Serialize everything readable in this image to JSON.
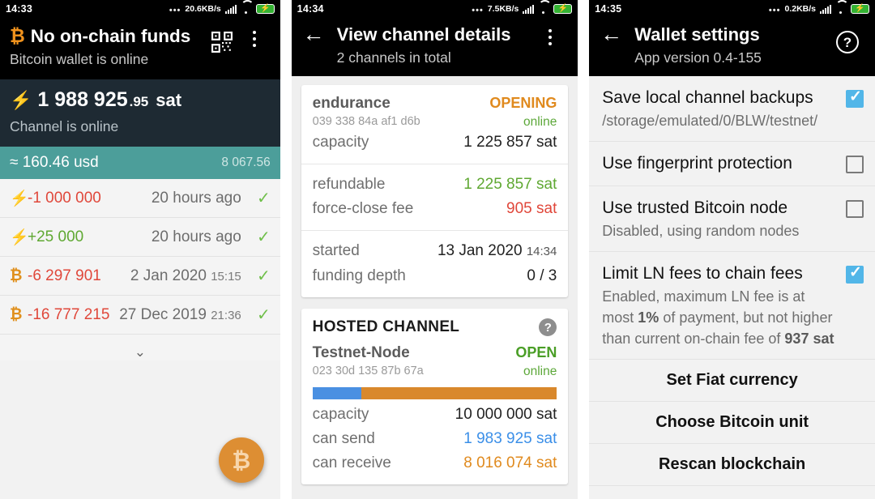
{
  "panel_wallet": {
    "status_bar": {
      "clock": "14:33",
      "dots": "•••",
      "speed": "20.6KB/s",
      "battery_glyph": "⚡"
    },
    "header": {
      "title": "No on-chain funds",
      "subtitle": "Bitcoin wallet is online",
      "btc_glyph": "₿",
      "qr_icon": "qr-code-icon",
      "menu_icon": "overflow-menu-icon"
    },
    "balance": {
      "bolt": "⚡",
      "integer": "1 988 925",
      "fraction": ".95",
      "unit": "sat",
      "status": "Channel is online"
    },
    "fiat": {
      "approx": "≈ 160.46 usd",
      "rate": "8 067.56"
    },
    "transactions": [
      {
        "kind": "lightning",
        "icon": "⚡",
        "amount": "-1 000 000",
        "sign": "neg",
        "date": "20 hours ago",
        "time": "",
        "check": "✓"
      },
      {
        "kind": "lightning",
        "icon": "⚡",
        "amount": "+25 000",
        "sign": "pos",
        "date": "20 hours ago",
        "time": "",
        "check": "✓"
      },
      {
        "kind": "onchain",
        "icon": "₿",
        "amount": "-6 297 901",
        "sign": "neg",
        "date": "2 Jan 2020",
        "time": "15:15",
        "check": "✓"
      },
      {
        "kind": "onchain",
        "icon": "₿",
        "amount": "-16 777 215",
        "sign": "neg",
        "date": "27 Dec 2019",
        "time": "21:36",
        "check": "✓"
      }
    ],
    "expand_chevron": "⌄",
    "fab_label": "₿"
  },
  "panel_channels": {
    "status_bar": {
      "clock": "14:34",
      "dots": "•••",
      "speed": "7.5KB/s",
      "battery_glyph": "⚡"
    },
    "header": {
      "back": "←",
      "title": "View channel details",
      "subtitle": "2 channels in total",
      "menu_icon": "overflow-menu-icon"
    },
    "channel_normal": {
      "name": "endurance",
      "node_id": "039 338 84a af1 d6b",
      "state": "OPENING",
      "online": "online",
      "rows_top": [
        {
          "key": "capacity",
          "value": "1 225 857 sat",
          "color": ""
        }
      ],
      "rows_mid": [
        {
          "key": "refundable",
          "value": "1 225 857 sat",
          "color": "green"
        },
        {
          "key": "force-close fee",
          "value": "905 sat",
          "color": "red"
        }
      ],
      "rows_bottom": [
        {
          "key": "started",
          "value": "13 Jan 2020",
          "value_small": "14:34",
          "color": ""
        },
        {
          "key": "funding depth",
          "value": "0 / 3",
          "color": ""
        }
      ]
    },
    "channel_hosted": {
      "section_title": "HOSTED CHANNEL",
      "help_badge": "?",
      "name": "Testnet-Node",
      "node_id": "023 30d 135 87b 67a",
      "state": "OPEN",
      "online": "online",
      "bar_blue_pct": 20,
      "rows": [
        {
          "key": "capacity",
          "value": "10 000 000 sat",
          "color": ""
        },
        {
          "key": "can send",
          "value": "1 983 925 sat",
          "color": "blue"
        },
        {
          "key": "can receive",
          "value": "8 016 074 sat",
          "color": "orange"
        }
      ]
    }
  },
  "panel_settings": {
    "status_bar": {
      "clock": "14:35",
      "dots": "•••",
      "speed": "0.2KB/s",
      "battery_glyph": "⚡"
    },
    "header": {
      "back": "←",
      "title": "Wallet settings",
      "subtitle": "App version 0.4-155",
      "help_icon": "?"
    },
    "settings": [
      {
        "title": "Save local channel backups",
        "desc": "/storage/emulated/0/BLW/testnet/",
        "checked": true
      },
      {
        "title": "Use fingerprint protection",
        "desc": "",
        "checked": false
      },
      {
        "title": "Use trusted Bitcoin node",
        "desc": "Disabled, using random nodes",
        "checked": false
      },
      {
        "title": "Limit LN fees to chain fees",
        "desc": "Enabled, maximum LN fee is at most 1% of payment, but not higher than current on-chain fee of 937 sat",
        "checked": true
      }
    ],
    "actions": [
      "Set Fiat currency",
      "Choose Bitcoin unit",
      "Rescan blockchain"
    ]
  },
  "colors": {
    "teal": "#4c9e9a",
    "bitcoin_orange": "#e0901d",
    "lightning_blue": "#3b8fe8",
    "positive_green": "#5fa832",
    "negative_red": "#e0473a",
    "checkbox_blue": "#52b6e8",
    "balance_bg": "#1e2a33"
  }
}
